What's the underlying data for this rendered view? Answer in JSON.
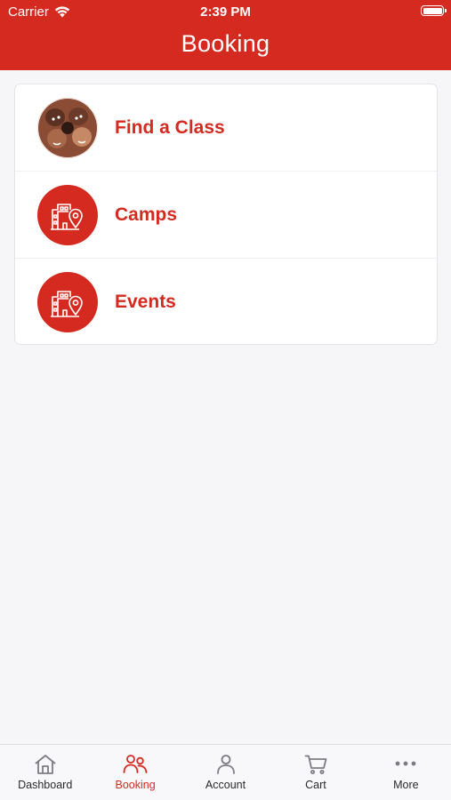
{
  "status_bar": {
    "carrier": "Carrier",
    "time": "2:39 PM"
  },
  "header": {
    "title": "Booking"
  },
  "booking_options": [
    {
      "label": "Find a Class",
      "icon": "group-photo"
    },
    {
      "label": "Camps",
      "icon": "building-location-icon"
    },
    {
      "label": "Events",
      "icon": "building-location-icon"
    }
  ],
  "tabs": [
    {
      "label": "Dashboard",
      "icon": "home-icon"
    },
    {
      "label": "Booking",
      "icon": "people-icon",
      "active": true
    },
    {
      "label": "Account",
      "icon": "person-icon"
    },
    {
      "label": "Cart",
      "icon": "cart-icon"
    },
    {
      "label": "More",
      "icon": "ellipsis-icon"
    }
  ],
  "colors": {
    "brand": "#d42a20",
    "background": "#f6f6f8",
    "tab_inactive": "#7c7c82"
  }
}
